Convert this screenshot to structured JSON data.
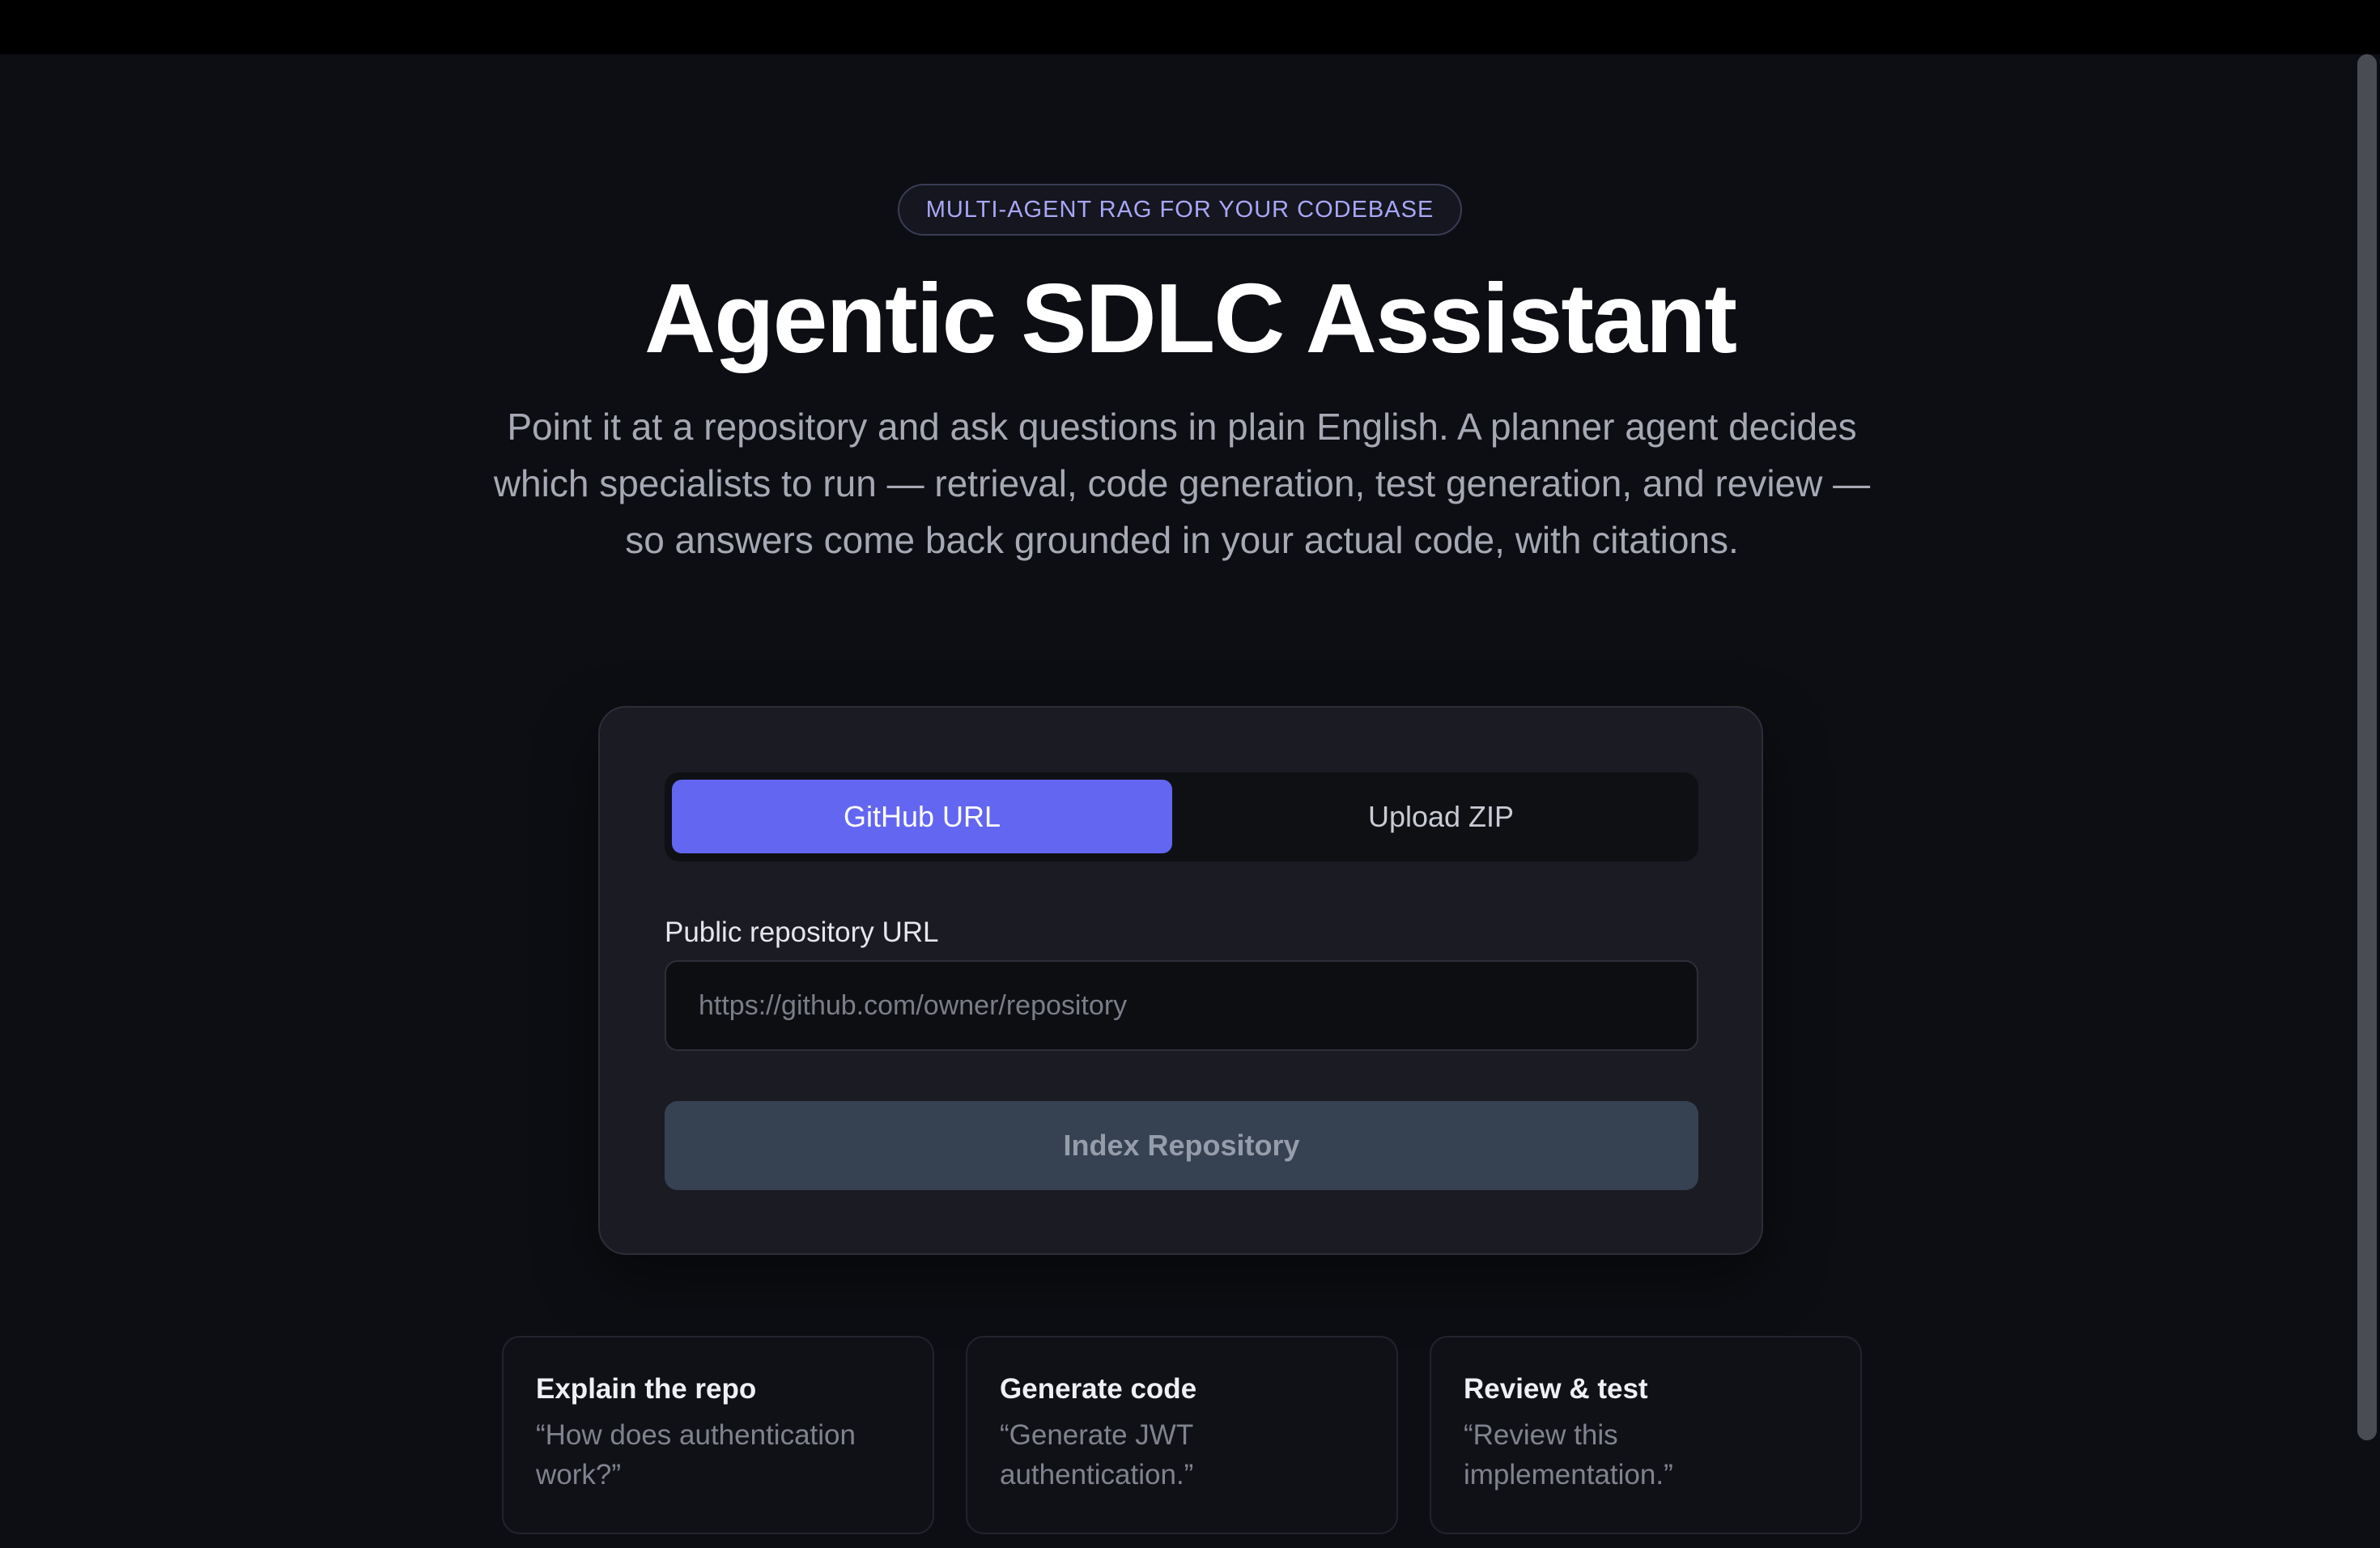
{
  "hero": {
    "badge": "MULTI-AGENT RAG FOR YOUR CODEBASE",
    "title": "Agentic SDLC Assistant",
    "subtitle": "Point it at a repository and ask questions in plain English. A planner agent decides which specialists to run — retrieval, code generation, test generation, and review — so answers come back grounded in your actual code, with citations."
  },
  "source_card": {
    "tabs": [
      {
        "label": "GitHub URL",
        "active": true
      },
      {
        "label": "Upload ZIP",
        "active": false
      }
    ],
    "url_label": "Public repository URL",
    "url_value": "",
    "url_placeholder": "https://github.com/owner/repository",
    "index_button": "Index Repository"
  },
  "features": [
    {
      "title": "Explain the repo",
      "example": "“How does authentication work?”"
    },
    {
      "title": "Generate code",
      "example": "“Generate JWT authentication.”"
    },
    {
      "title": "Review & test",
      "example": "“Review this implementation.”"
    }
  ],
  "colors": {
    "accent": "#6366f1",
    "background": "#0d0e13",
    "card": "#1a1b23",
    "button_disabled": "#364152"
  }
}
